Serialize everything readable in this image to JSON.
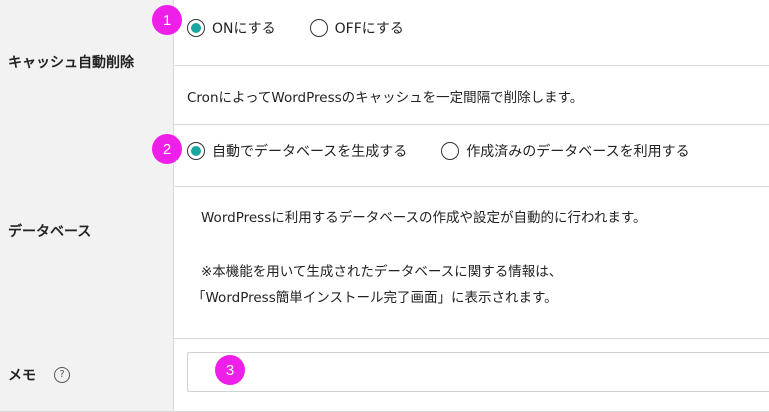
{
  "cache": {
    "label": "キャッシュ自動削除",
    "options": [
      {
        "label": "ONにする",
        "checked": true
      },
      {
        "label": "OFFにする",
        "checked": false
      }
    ],
    "description": "CronによってWordPressのキャッシュを一定間隔で削除します。"
  },
  "database": {
    "label": "データベース",
    "options": [
      {
        "label": "自動でデータベースを生成する",
        "checked": true
      },
      {
        "label": "作成済みのデータベースを利用する",
        "checked": false
      }
    ],
    "description_line1": "WordPressに利用するデータベースの作成や設定が自動的に行われます。",
    "note_line1": "※本機能を用いて生成されたデータベースに関する情報は、",
    "note_line2": "「WordPress簡単インストール完了画面」に表示されます。"
  },
  "memo": {
    "label": "メモ",
    "help_glyph": "?",
    "value": "",
    "placeholder": ""
  },
  "badges": [
    "1",
    "2",
    "3"
  ],
  "colors": {
    "accent": "#1aa6a0",
    "badge": "#ee1fe8",
    "label_bg": "#f2f2f2",
    "border": "#d9d9d9"
  }
}
